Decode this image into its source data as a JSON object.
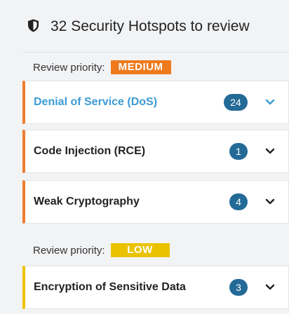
{
  "header": {
    "icon": "shield-icon",
    "title": "32 Security Hotspots to review"
  },
  "groups": [
    {
      "label": "Review priority:",
      "priority": "MEDIUM",
      "color": "#ee7a1d",
      "categories": [
        {
          "name": "Denial of Service (DoS)",
          "count": "24",
          "selected": true
        },
        {
          "name": "Code Injection (RCE)",
          "count": "1",
          "selected": false
        },
        {
          "name": "Weak Cryptography",
          "count": "4",
          "selected": false
        }
      ]
    },
    {
      "label": "Review priority:",
      "priority": "LOW",
      "color": "#eac200",
      "categories": [
        {
          "name": "Encryption of Sensitive Data",
          "count": "3",
          "selected": false
        }
      ]
    }
  ],
  "colors": {
    "count_badge": "#236a97",
    "selected_text": "#3c9bd4",
    "chevron_default": "#222222",
    "chevron_selected": "#3c9bd4"
  }
}
